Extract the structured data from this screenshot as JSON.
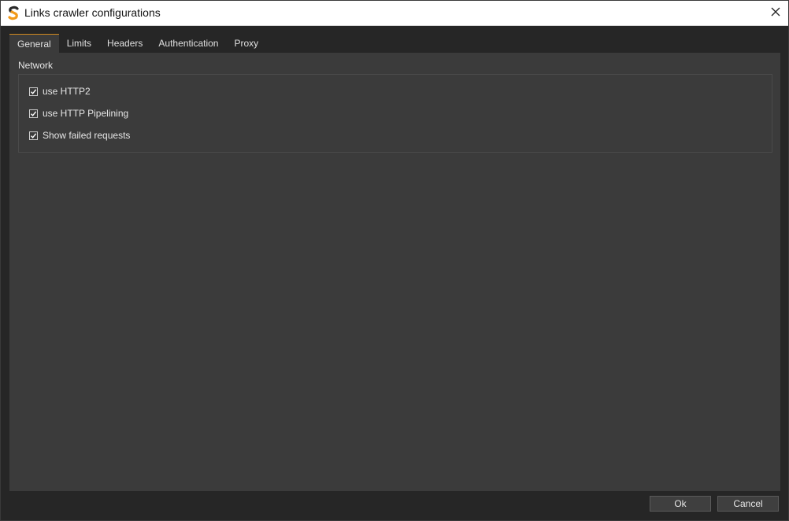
{
  "window": {
    "title": "Links crawler configurations"
  },
  "tabs": [
    {
      "label": "General",
      "active": true
    },
    {
      "label": "Limits",
      "active": false
    },
    {
      "label": "Headers",
      "active": false
    },
    {
      "label": "Authentication",
      "active": false
    },
    {
      "label": "Proxy",
      "active": false
    }
  ],
  "network": {
    "title": "Network",
    "options": [
      {
        "label": "use HTTP2",
        "checked": true
      },
      {
        "label": "use HTTP Pipelining",
        "checked": true
      },
      {
        "label": "Show failed requests",
        "checked": true
      }
    ]
  },
  "buttons": {
    "ok": "Ok",
    "cancel": "Cancel"
  },
  "colors": {
    "accent": "#d28a1e",
    "panel": "#3b3b3b",
    "background": "#262626"
  },
  "icons": {
    "app": "app-logo-icon",
    "close": "close-icon",
    "check": "checkmark-icon"
  }
}
